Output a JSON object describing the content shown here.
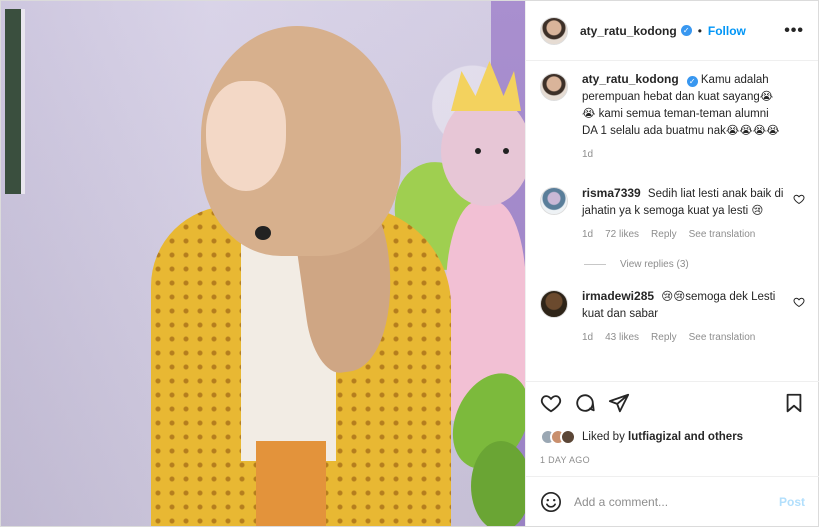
{
  "post": {
    "author": "aty_ratu_kodong",
    "separator": "•",
    "follow_label": "Follow",
    "more_label": "•••"
  },
  "caption": {
    "username": "aty_ratu_kodong",
    "text": "Kamu adalah perempuan hebat dan kuat sayang😭😭 kami semua teman-teman alumni DA 1 selalu ada buatmu nak😭😭😭😭",
    "time": "1d"
  },
  "comments": [
    {
      "username": "risma7339",
      "text": "Sedih liat lesti anak baik di jahatin ya k semoga kuat ya lesti 😢",
      "time": "1d",
      "likes": "72 likes",
      "reply_label": "Reply",
      "translate_label": "See translation",
      "view_replies": "View replies (3)"
    },
    {
      "username": "irmadewi285",
      "text": "😢😢semoga dek Lesti kuat dan sabar",
      "time": "1d",
      "likes": "43 likes",
      "reply_label": "Reply",
      "translate_label": "See translation"
    }
  ],
  "likes": {
    "prefix": "Liked by",
    "user": "lutfiagizal",
    "suffix": "and others"
  },
  "date": "1 DAY AGO",
  "add_comment": {
    "placeholder": "Add a comment...",
    "post_label": "Post"
  },
  "icons": {
    "heart": "heart-icon",
    "comment": "comment-icon",
    "share": "paper-plane-icon",
    "save": "bookmark-icon",
    "emoji": "emoji-icon",
    "verified": "verified-badge-icon"
  },
  "colors": {
    "link": "#0095f6",
    "verified": "#3897f0",
    "muted": "#8e8e8e",
    "post_disabled": "#b2dffc"
  }
}
